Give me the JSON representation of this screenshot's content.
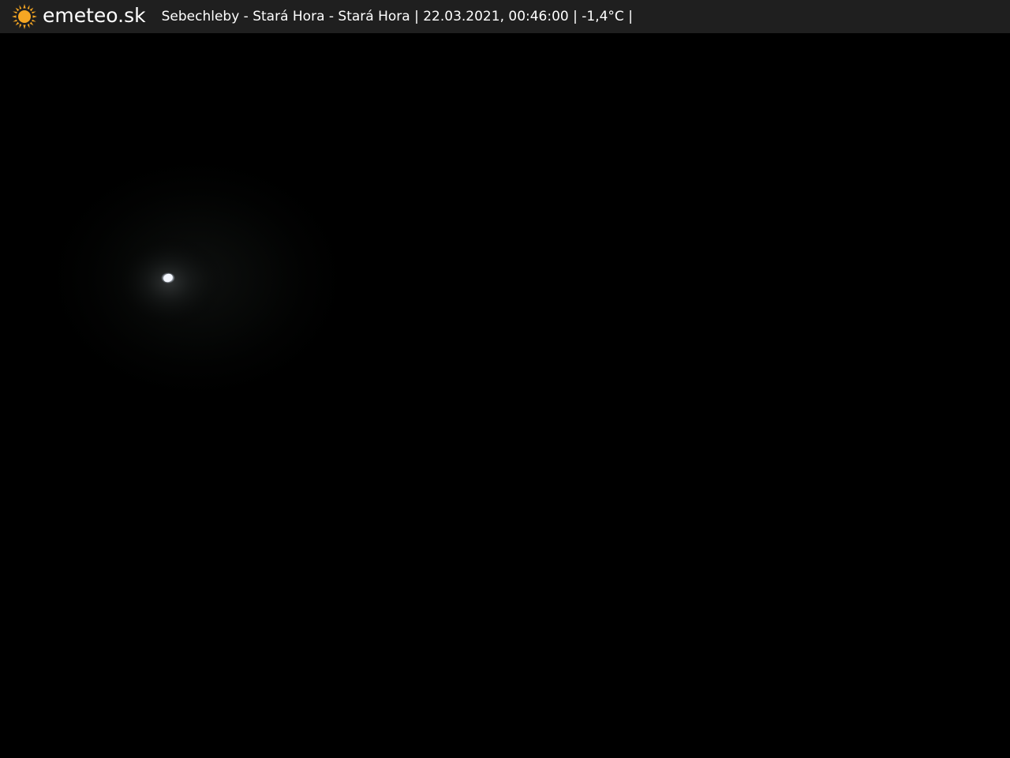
{
  "header": {
    "logo_text": "emeteo.sk",
    "caption": "Sebechleby - Stará Hora - Stará Hora | 22.03.2021, 00:46:00 | -1,4°C |"
  },
  "icons": {
    "logo": "sun-icon"
  },
  "colors": {
    "topbar_bg": "#1f1f1f",
    "sun": "#f5a623",
    "scene_bg": "#000000",
    "moon": "#f4f7ff"
  }
}
